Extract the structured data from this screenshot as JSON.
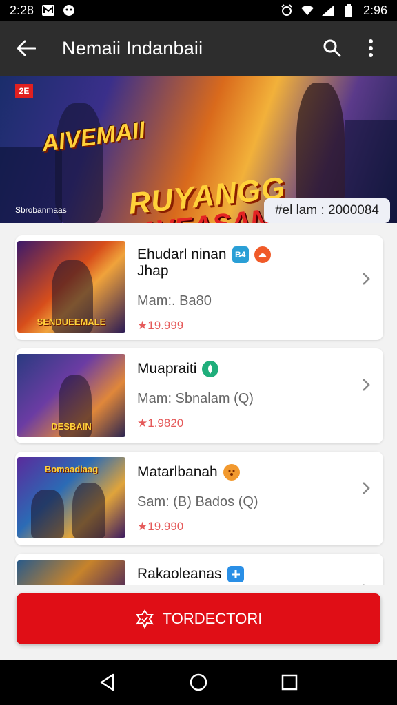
{
  "status_bar": {
    "time_left": "2:28",
    "time_right": "2:96"
  },
  "app_bar": {
    "title": "Nemaii Indanbaii"
  },
  "banner": {
    "logo_text": "2E",
    "title_line1": "AIVEMAII",
    "title_line2": "RUYANGG",
    "title_line3": "AVEASAN",
    "small_text": "Sbrobanmaas",
    "pill_text": "#el lam : 2000084"
  },
  "games": [
    {
      "name": "Ehudarl ninan",
      "name_line2": "Jhap",
      "badge1_text": "B4",
      "badge1_color": "#2a9fd6",
      "badge2_color": "#f05a28",
      "meta": "Mam:. Ba80",
      "rating": "★19.999",
      "thumb_caption": "SENDUEEMALE"
    },
    {
      "name": "Muapraiti",
      "badge1_color": "#1fae7b",
      "meta": "Mam: Sbnalam (Q)",
      "rating": "★1.9820",
      "thumb_caption": "DESBAIN"
    },
    {
      "name": "Matarlbanah",
      "badge1_color": "#f2992e",
      "meta": "Sam: (B) Bados (Q)",
      "rating": "★19.990",
      "thumb_caption": "Bomaadiaag"
    },
    {
      "name": "Rakaoleanas",
      "badge1_color": "#2a8fe6"
    }
  ],
  "cta": {
    "label": "TORDECTORI"
  },
  "colors": {
    "accent": "#e00e16",
    "app_bar": "#2d2d2d"
  }
}
